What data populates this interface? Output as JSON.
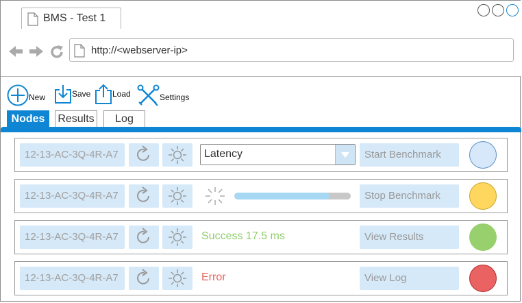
{
  "window": {
    "tab_title": "BMS - Test 1",
    "url": "http://<webserver-ip>"
  },
  "toolbar": {
    "new_label": "New",
    "save_label": "Save",
    "load_label": "Load",
    "settings_label": "Settings"
  },
  "tabs": [
    {
      "label": "Nodes",
      "active": true
    },
    {
      "label": "Results",
      "active": false
    },
    {
      "label": "Log",
      "active": false
    }
  ],
  "rows": [
    {
      "node_id": "12-13-AC-3Q-4R-A7",
      "mode": "select",
      "select_value": "Latency",
      "action": "Start Benchmark",
      "status_color": "#d6e8fa"
    },
    {
      "node_id": "12-13-AC-3Q-4R-A7",
      "mode": "progress",
      "progress": 0.82,
      "action": "Stop Benchmark",
      "status_color": "#ffd75e"
    },
    {
      "node_id": "12-13-AC-3Q-4R-A7",
      "mode": "text",
      "status_text": "Success 17.5 ms",
      "status_text_color": "#8fcd6a",
      "action": "View Results",
      "status_color": "#97d06c"
    },
    {
      "node_id": "12-13-AC-3Q-4R-A7",
      "mode": "text",
      "status_text": "Error",
      "status_text_color": "#e8625f",
      "action": "View Log",
      "status_color": "#ea6262"
    }
  ],
  "colors": {
    "accent": "#0e86d4",
    "chip_bg": "#d6e9f8"
  }
}
